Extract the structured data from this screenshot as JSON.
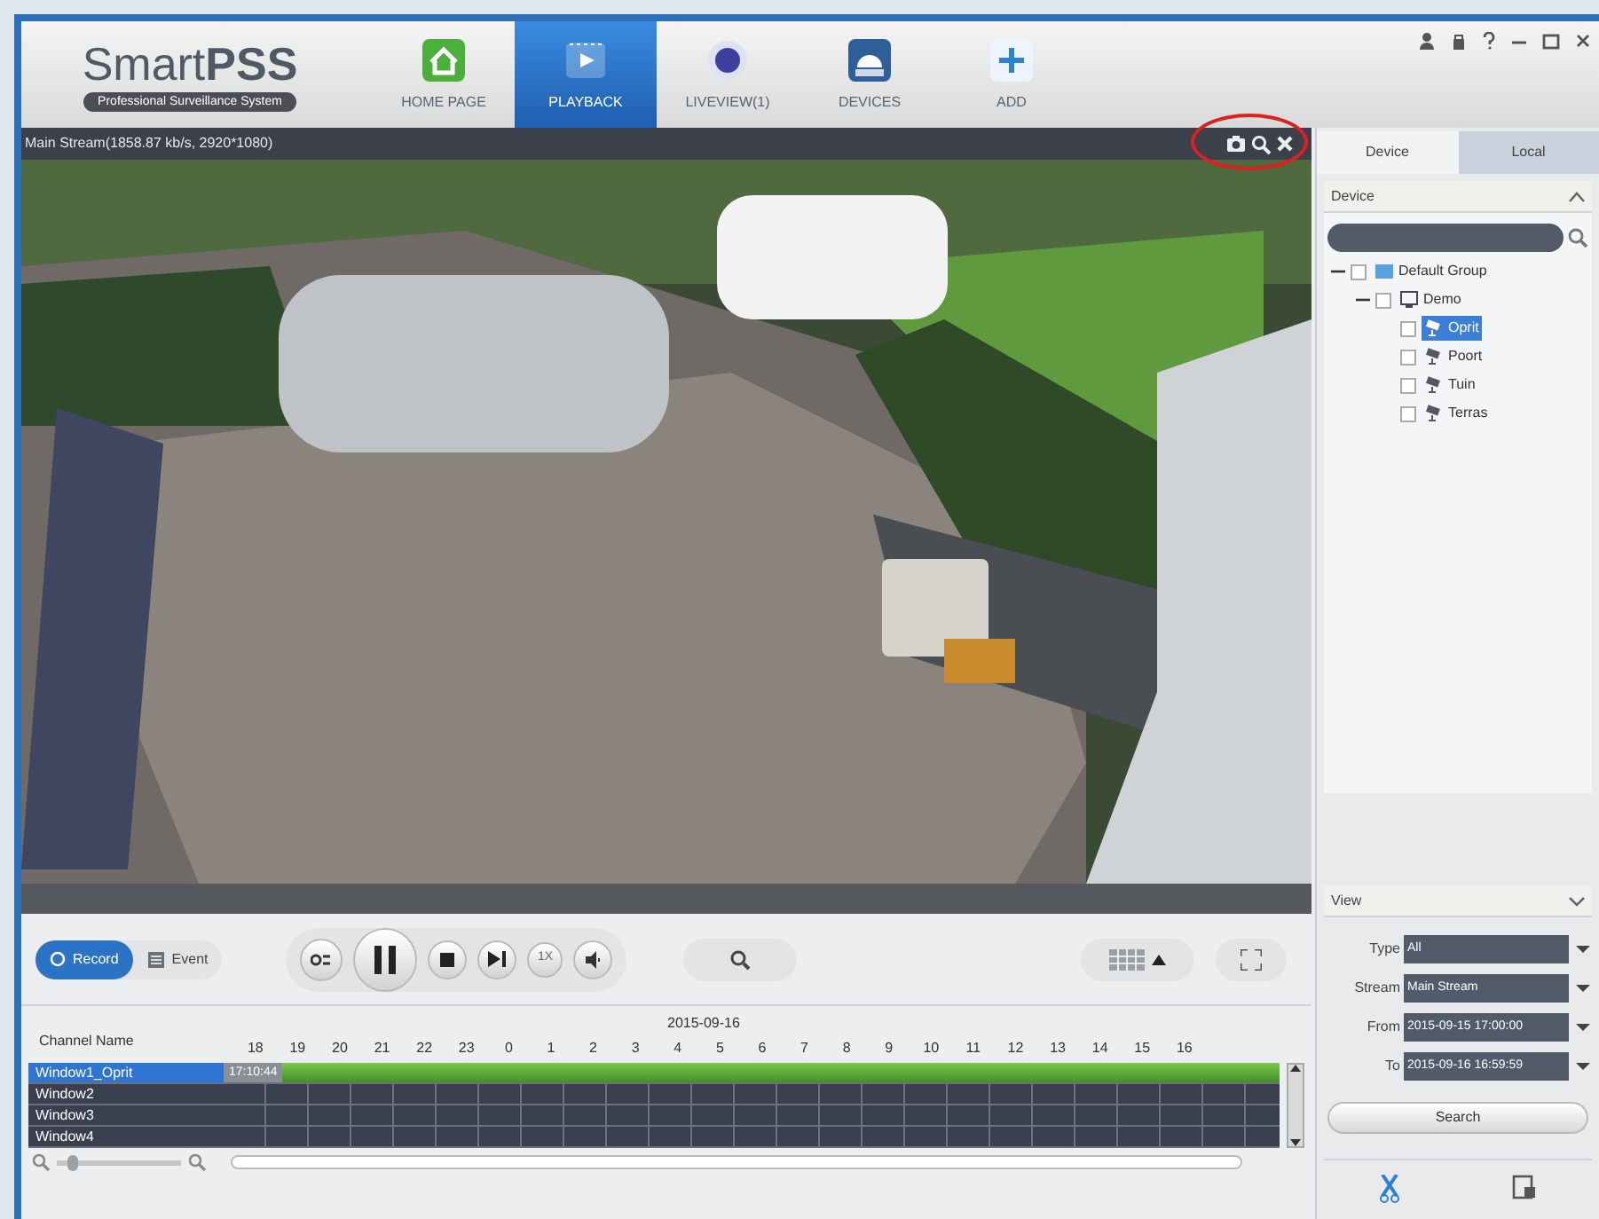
{
  "app": {
    "logo": "Smart**PSS**",
    "subtitle": "Professional Surveillance System"
  },
  "nav": [
    {
      "label": "HOME PAGE",
      "selected": false,
      "kind": "home"
    },
    {
      "label": "PLAYBACK",
      "selected": true,
      "kind": "playback"
    },
    {
      "label": "LIVEVIEW(1)",
      "selected": false,
      "kind": "liveview"
    },
    {
      "label": "DEVICES",
      "selected": false,
      "kind": "devices"
    },
    {
      "label": "ADD",
      "selected": false,
      "kind": "add"
    }
  ],
  "video": {
    "stream_info": "Main Stream(1858.87 kb/s, 2920*1080)"
  },
  "side_tabs": [
    {
      "label": "Device",
      "selected": true
    },
    {
      "label": "Local",
      "selected": false
    }
  ],
  "device_panel": {
    "title": "Device",
    "tree": [
      {
        "label": "Default Group",
        "checked": false,
        "expanded": true,
        "selected": false,
        "kind": "group",
        "children": [
          {
            "label": "Demo",
            "checked": false,
            "expanded": true,
            "selected": false,
            "kind": "device",
            "children": [
              {
                "label": "Oprit",
                "checked": false,
                "selected": true,
                "kind": "camera"
              },
              {
                "label": "Poort",
                "checked": false,
                "selected": false,
                "kind": "camera"
              },
              {
                "label": "Tuin",
                "checked": false,
                "selected": false,
                "kind": "camera"
              },
              {
                "label": "Terras",
                "checked": false,
                "selected": false,
                "kind": "camera"
              }
            ]
          }
        ]
      }
    ]
  },
  "view_panel": {
    "title": "View",
    "fields": [
      {
        "label": "Type",
        "value": "All"
      },
      {
        "label": "Stream",
        "value": "Main Stream"
      },
      {
        "label": "From",
        "value": "2015-09-15 17:00:00"
      },
      {
        "label": "To",
        "value": "2015-09-16 16:59:59"
      }
    ],
    "search_button": "Search"
  },
  "mode_tabs": [
    {
      "label": "Record",
      "selected": true
    },
    {
      "label": "Event",
      "selected": false
    }
  ],
  "speed": "1X",
  "timeline_zoom": {
    "level": 0.1
  },
  "timeline": {
    "channel_header": "Channel Name",
    "date": "2015-09-16",
    "hours": [
      "18",
      "19",
      "20",
      "21",
      "22",
      "23",
      "0",
      "1",
      "2",
      "3",
      "4",
      "5",
      "6",
      "7",
      "8",
      "9",
      "10",
      "11",
      "12",
      "13",
      "14",
      "15",
      "16"
    ],
    "rows": [
      {
        "name": "Window1_Oprit",
        "selected": true,
        "recording": true,
        "start_time": "17:10:44"
      },
      {
        "name": "Window2",
        "selected": false,
        "recording": false
      },
      {
        "name": "Window3",
        "selected": false,
        "recording": false
      },
      {
        "name": "Window4",
        "selected": false,
        "recording": false
      }
    ]
  }
}
